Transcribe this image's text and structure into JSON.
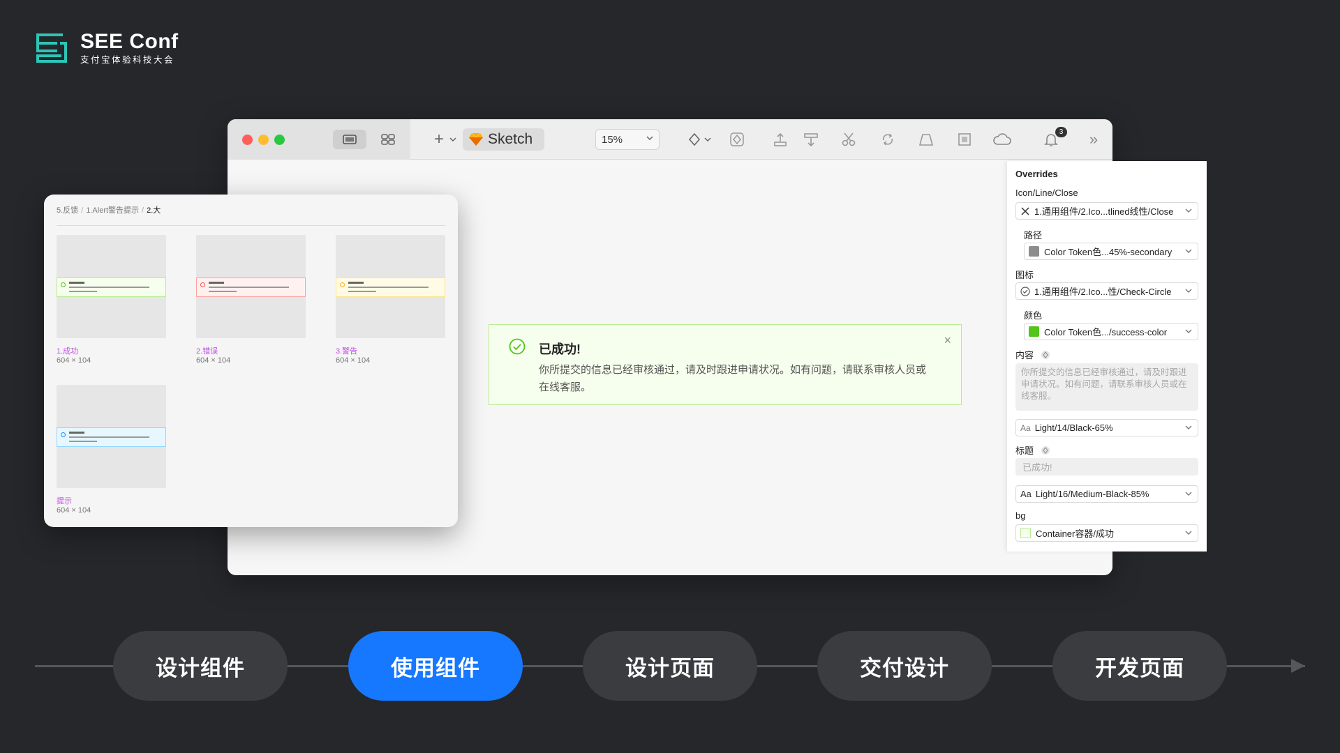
{
  "brand": {
    "title": "SEE Conf",
    "subtitle": "支付宝体验科技大会"
  },
  "toolbar": {
    "app_name": "Sketch",
    "zoom": "15%",
    "notification_count": "3"
  },
  "alert": {
    "title": "已成功!",
    "body": "你所提交的信息已经审核通过，请及时跟进申请状况。如有问题，请联系审核人员或在线客服。",
    "close": "×",
    "colors": {
      "bg": "#f6ffed",
      "border": "#b7eb8f",
      "icon": "#52c41a"
    }
  },
  "overrides": {
    "heading": "Overrides",
    "close_icon_label": "Icon/Line/Close",
    "close_icon_value": "1.通用组件/2.Ico...tlined线性/Close",
    "path_label": "路径",
    "path_value": "Color Token色...45%-secondary",
    "icon_label": "图标",
    "icon_value": "1.通用组件/2.Ico...性/Check-Circle",
    "color_label": "颜色",
    "color_value": "Color Token色.../success-color",
    "content_label": "内容",
    "content_placeholder": "你所提交的信息已经审核通过，请及时跟进申请状况。如有问题，请联系审核人员或在线客服。",
    "content_style": "Light/14/Black-65%",
    "title_label": "标题",
    "title_placeholder": "已成功!",
    "title_style": "Light/16/Medium-Black-85%",
    "bg_label": "bg",
    "bg_value": "Container容器/成功",
    "swatches": {
      "path": "#8c8c8c",
      "color": "#52c41a",
      "bg": "#f6ffed"
    }
  },
  "library": {
    "breadcrumb": [
      "5.反馈",
      "1.Alert警告提示",
      "2.大"
    ],
    "items": [
      {
        "name": "1.成功",
        "size": "604 × 104",
        "bg": "#f6ffed",
        "border": "#b7eb8f",
        "dot": "#52c41a"
      },
      {
        "name": "2.错误",
        "size": "604 × 104",
        "bg": "#fff1f0",
        "border": "#ffa39e",
        "dot": "#ff4d4f"
      },
      {
        "name": "3.警告",
        "size": "604 × 104",
        "bg": "#fffbe6",
        "border": "#ffe58f",
        "dot": "#faad14"
      },
      {
        "name": "提示",
        "size": "604 × 104",
        "bg": "#e6f7ff",
        "border": "#91d5ff",
        "dot": "#1890ff"
      }
    ]
  },
  "flow": {
    "steps": [
      "设计组件",
      "使用组件",
      "设计页面",
      "交付设计",
      "开发页面"
    ],
    "active_index": 1,
    "colors": {
      "active": "#1677ff",
      "inactive": "#3b3c40"
    }
  }
}
